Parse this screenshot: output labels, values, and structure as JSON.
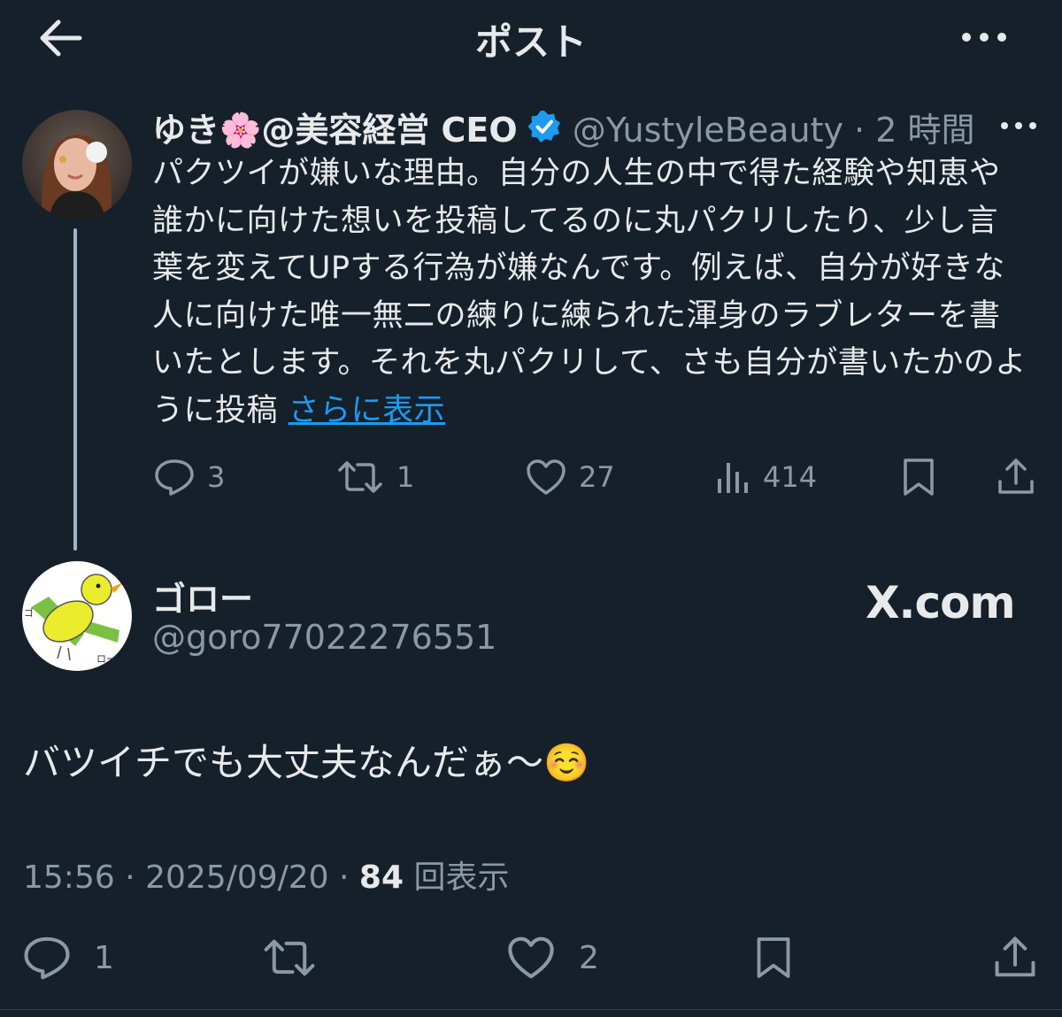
{
  "header": {
    "title": "ポスト",
    "back_icon": "arrow-left-icon",
    "more_icon": "more-horizontal-icon"
  },
  "quoted_post": {
    "display_name": "ゆき🌸@美容経営 CEO",
    "verified": true,
    "handle_time": "@YustyleBeauty · 2 時間",
    "text": "パクツイが嫌いな理由。自分の人生の中で得た経験や知恵や誰かに向けた想いを投稿してるのに丸パクリしたり、少し言葉を変えてUPする行為が嫌なんです。例えば、自分が好きな人に向けた唯一無二の練りに練られた渾身のラブレターを書いたとします。それを丸パクリして、さも自分が書いたかのように投稿",
    "show_more": "さらに表示",
    "actions": {
      "replies": "3",
      "reposts": "1",
      "likes": "27",
      "views": "414"
    }
  },
  "reply_post": {
    "display_name": "ゴロー",
    "handle": "@goro77022276551",
    "watermark": "X.com",
    "text": "バツイチでも大丈夫なんだぁ〜☺️",
    "meta_prefix": "15:56 · 2025/09/20 · ",
    "view_count": "84",
    "view_label": "回表示",
    "actions": {
      "replies": "1",
      "likes": "2"
    }
  },
  "colors": {
    "background": "#15202b",
    "text": "#e7e9ea",
    "muted": "#8b98a5",
    "link": "#1d9bf0",
    "verified": "#1d9bf0"
  }
}
